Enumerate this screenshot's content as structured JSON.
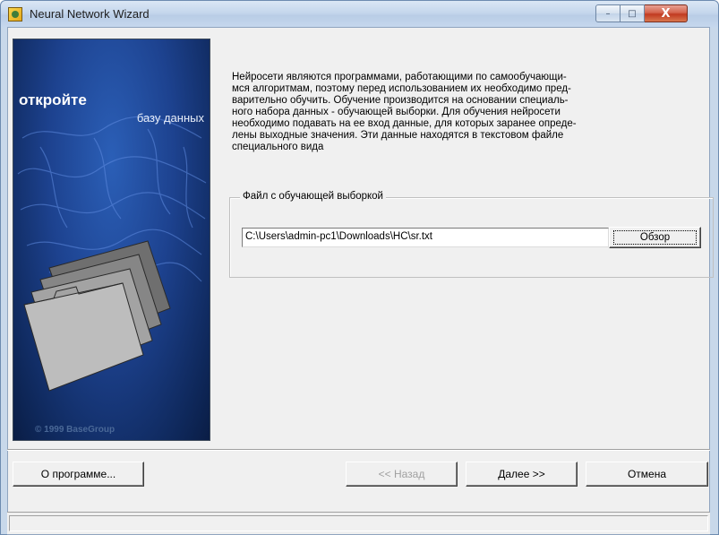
{
  "window": {
    "title": "Neural Network Wizard",
    "minimize_glyph": "–",
    "maximize_glyph": "□",
    "close_glyph": "X"
  },
  "banner": {
    "title": "откройте",
    "subtitle": "базу данных",
    "copyright": "© 1999 BaseGroup"
  },
  "description": {
    "lines": [
      "Нейросети являются программами, работающими по самообучающи-",
      "мся алгоритмам, поэтому перед использованием их необходимо пред-",
      "варительно обучить. Обучение производится на основании специаль-",
      "ного набора данных - обучающей выборки. Для обучения нейросети",
      "необходимо подавать на ее вход данные, для которых заранее опреде-",
      "лены выходные значения. Эти данные находятся в текстовом файле",
      "специального вида"
    ]
  },
  "training_file": {
    "group_label": "Файл с обучающей выборкой",
    "path_value": "C:\\Users\\admin-pc1\\Downloads\\НС\\sr.txt",
    "browse_label": "Обзор"
  },
  "buttons": {
    "about": "О программе...",
    "back": "<< Назад",
    "next": "Далее >>",
    "cancel": "Отмена"
  },
  "colors": {
    "banner_blue": "#1d428f",
    "close_red": "#c13a20",
    "face": "#f0f0f0"
  }
}
